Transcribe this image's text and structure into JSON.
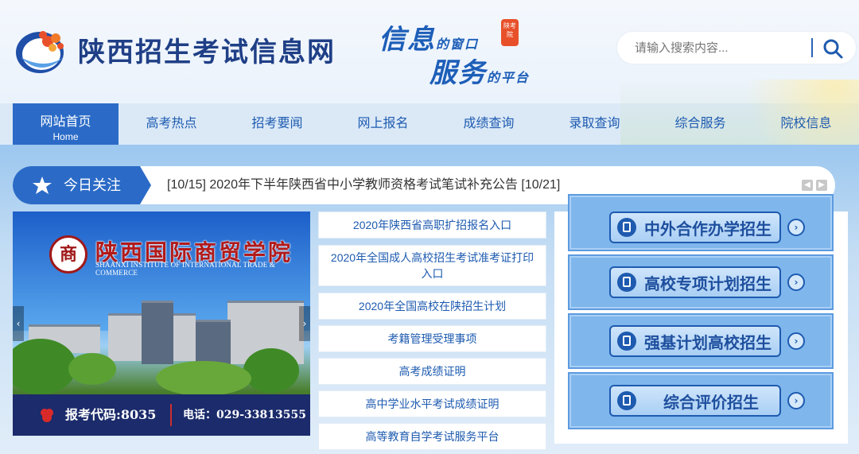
{
  "header": {
    "site_title": "陕西招生考试信息网",
    "slogan_line1_big": "信息",
    "slogan_line1_small": "的窗口",
    "slogan_line2_big": "服务",
    "slogan_line2_small": "的平台",
    "seal_text": "陕考院",
    "search_placeholder": "请输入搜索内容...",
    "logo_icon": "shaanxi-exam-logo-icon",
    "search_icon": "search-icon"
  },
  "nav": {
    "items": [
      {
        "label": "网站首页",
        "sub": "Home",
        "active": true
      },
      {
        "label": "高考热点"
      },
      {
        "label": "招考要闻"
      },
      {
        "label": "网上报名"
      },
      {
        "label": "成绩查询"
      },
      {
        "label": "录取查询"
      },
      {
        "label": "综合服务"
      },
      {
        "label": "院校信息"
      }
    ]
  },
  "today": {
    "label": "今日关注",
    "headline": "[10/15]  2020年下半年陕西省中小学教师资格考试笔试补充公告  [10/21]",
    "icon": "star-icon",
    "prev_icon": "chevron-left-icon",
    "next_icon": "chevron-right-icon"
  },
  "banner": {
    "school_cn": "陕西国际商贸学院",
    "school_en": "SHAANXI INSTITUTE OF INTERNATIONAL TRADE & COMMERCE",
    "emblem_text": "商",
    "code": "报考代码:8035",
    "phone": "电话：029-33813555",
    "prev_arrow": "‹",
    "next_arrow": "›"
  },
  "links": [
    "2020年陕西省高职扩招报名入口",
    "2020年全国成人高校招生考试准考证打印入口",
    "2020年全国高校在陕招生计划",
    "考籍管理受理事项",
    "高考成绩证明",
    "高中学业水平考试成绩证明",
    "高等教育自学考试服务平台"
  ],
  "cards": [
    {
      "label": "中外合作办学招生"
    },
    {
      "label": "高校专项计划招生"
    },
    {
      "label": "强基计划高校招生"
    },
    {
      "label": "综合评价招生"
    }
  ],
  "colors": {
    "primary": "#2b6bc7",
    "title": "#1f3f86",
    "link": "#1e5bb0"
  }
}
